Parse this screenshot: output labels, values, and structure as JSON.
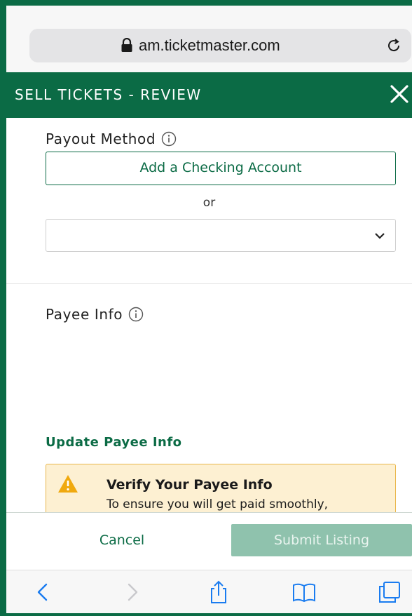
{
  "browser": {
    "url": "am.ticketmaster.com",
    "icons": [
      "lock-icon",
      "reload-icon"
    ]
  },
  "header": {
    "title": "SELL TICKETS  -  REVIEW",
    "close_icon": "close-icon"
  },
  "payout": {
    "title": "Payout Method",
    "add_account_label": "Add a Checking Account",
    "or_label": "or",
    "select_value": ""
  },
  "payee": {
    "title": "Payee Info",
    "update_link": "Update Payee Info"
  },
  "alert": {
    "title": "Verify Your Payee Info",
    "body": "To ensure you will get paid smoothly,"
  },
  "footer": {
    "cancel_label": "Cancel",
    "submit_label": "Submit Listing"
  },
  "toolbar": {
    "icons": [
      "back-icon",
      "forward-icon",
      "share-icon",
      "bookmarks-icon",
      "tabs-icon"
    ]
  },
  "colors": {
    "brand_green": "#0b6b45",
    "submit_disabled": "#8fc2ad",
    "alert_bg": "#fdf0d2",
    "alert_border": "#e9b64a",
    "ios_blue": "#1a7cf0"
  }
}
